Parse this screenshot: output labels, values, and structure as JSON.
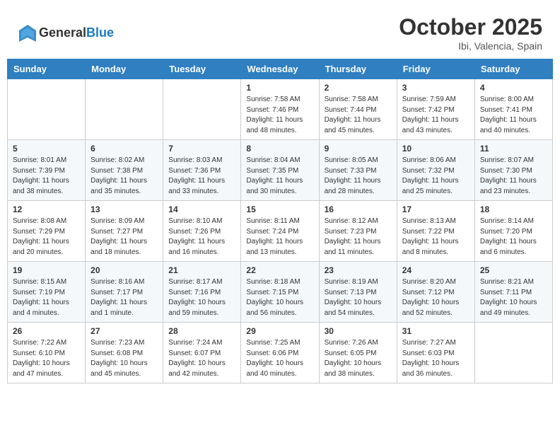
{
  "logo": {
    "general": "General",
    "blue": "Blue"
  },
  "header": {
    "month": "October 2025",
    "location": "Ibi, Valencia, Spain"
  },
  "weekdays": [
    "Sunday",
    "Monday",
    "Tuesday",
    "Wednesday",
    "Thursday",
    "Friday",
    "Saturday"
  ],
  "weeks": [
    [
      {
        "day": "",
        "info": ""
      },
      {
        "day": "",
        "info": ""
      },
      {
        "day": "",
        "info": ""
      },
      {
        "day": "1",
        "info": "Sunrise: 7:58 AM\nSunset: 7:46 PM\nDaylight: 11 hours\nand 48 minutes."
      },
      {
        "day": "2",
        "info": "Sunrise: 7:58 AM\nSunset: 7:44 PM\nDaylight: 11 hours\nand 45 minutes."
      },
      {
        "day": "3",
        "info": "Sunrise: 7:59 AM\nSunset: 7:42 PM\nDaylight: 11 hours\nand 43 minutes."
      },
      {
        "day": "4",
        "info": "Sunrise: 8:00 AM\nSunset: 7:41 PM\nDaylight: 11 hours\nand 40 minutes."
      }
    ],
    [
      {
        "day": "5",
        "info": "Sunrise: 8:01 AM\nSunset: 7:39 PM\nDaylight: 11 hours\nand 38 minutes."
      },
      {
        "day": "6",
        "info": "Sunrise: 8:02 AM\nSunset: 7:38 PM\nDaylight: 11 hours\nand 35 minutes."
      },
      {
        "day": "7",
        "info": "Sunrise: 8:03 AM\nSunset: 7:36 PM\nDaylight: 11 hours\nand 33 minutes."
      },
      {
        "day": "8",
        "info": "Sunrise: 8:04 AM\nSunset: 7:35 PM\nDaylight: 11 hours\nand 30 minutes."
      },
      {
        "day": "9",
        "info": "Sunrise: 8:05 AM\nSunset: 7:33 PM\nDaylight: 11 hours\nand 28 minutes."
      },
      {
        "day": "10",
        "info": "Sunrise: 8:06 AM\nSunset: 7:32 PM\nDaylight: 11 hours\nand 25 minutes."
      },
      {
        "day": "11",
        "info": "Sunrise: 8:07 AM\nSunset: 7:30 PM\nDaylight: 11 hours\nand 23 minutes."
      }
    ],
    [
      {
        "day": "12",
        "info": "Sunrise: 8:08 AM\nSunset: 7:29 PM\nDaylight: 11 hours\nand 20 minutes."
      },
      {
        "day": "13",
        "info": "Sunrise: 8:09 AM\nSunset: 7:27 PM\nDaylight: 11 hours\nand 18 minutes."
      },
      {
        "day": "14",
        "info": "Sunrise: 8:10 AM\nSunset: 7:26 PM\nDaylight: 11 hours\nand 16 minutes."
      },
      {
        "day": "15",
        "info": "Sunrise: 8:11 AM\nSunset: 7:24 PM\nDaylight: 11 hours\nand 13 minutes."
      },
      {
        "day": "16",
        "info": "Sunrise: 8:12 AM\nSunset: 7:23 PM\nDaylight: 11 hours\nand 11 minutes."
      },
      {
        "day": "17",
        "info": "Sunrise: 8:13 AM\nSunset: 7:22 PM\nDaylight: 11 hours\nand 8 minutes."
      },
      {
        "day": "18",
        "info": "Sunrise: 8:14 AM\nSunset: 7:20 PM\nDaylight: 11 hours\nand 6 minutes."
      }
    ],
    [
      {
        "day": "19",
        "info": "Sunrise: 8:15 AM\nSunset: 7:19 PM\nDaylight: 11 hours\nand 4 minutes."
      },
      {
        "day": "20",
        "info": "Sunrise: 8:16 AM\nSunset: 7:17 PM\nDaylight: 11 hours\nand 1 minute."
      },
      {
        "day": "21",
        "info": "Sunrise: 8:17 AM\nSunset: 7:16 PM\nDaylight: 10 hours\nand 59 minutes."
      },
      {
        "day": "22",
        "info": "Sunrise: 8:18 AM\nSunset: 7:15 PM\nDaylight: 10 hours\nand 56 minutes."
      },
      {
        "day": "23",
        "info": "Sunrise: 8:19 AM\nSunset: 7:13 PM\nDaylight: 10 hours\nand 54 minutes."
      },
      {
        "day": "24",
        "info": "Sunrise: 8:20 AM\nSunset: 7:12 PM\nDaylight: 10 hours\nand 52 minutes."
      },
      {
        "day": "25",
        "info": "Sunrise: 8:21 AM\nSunset: 7:11 PM\nDaylight: 10 hours\nand 49 minutes."
      }
    ],
    [
      {
        "day": "26",
        "info": "Sunrise: 7:22 AM\nSunset: 6:10 PM\nDaylight: 10 hours\nand 47 minutes."
      },
      {
        "day": "27",
        "info": "Sunrise: 7:23 AM\nSunset: 6:08 PM\nDaylight: 10 hours\nand 45 minutes."
      },
      {
        "day": "28",
        "info": "Sunrise: 7:24 AM\nSunset: 6:07 PM\nDaylight: 10 hours\nand 42 minutes."
      },
      {
        "day": "29",
        "info": "Sunrise: 7:25 AM\nSunset: 6:06 PM\nDaylight: 10 hours\nand 40 minutes."
      },
      {
        "day": "30",
        "info": "Sunrise: 7:26 AM\nSunset: 6:05 PM\nDaylight: 10 hours\nand 38 minutes."
      },
      {
        "day": "31",
        "info": "Sunrise: 7:27 AM\nSunset: 6:03 PM\nDaylight: 10 hours\nand 36 minutes."
      },
      {
        "day": "",
        "info": ""
      }
    ]
  ]
}
